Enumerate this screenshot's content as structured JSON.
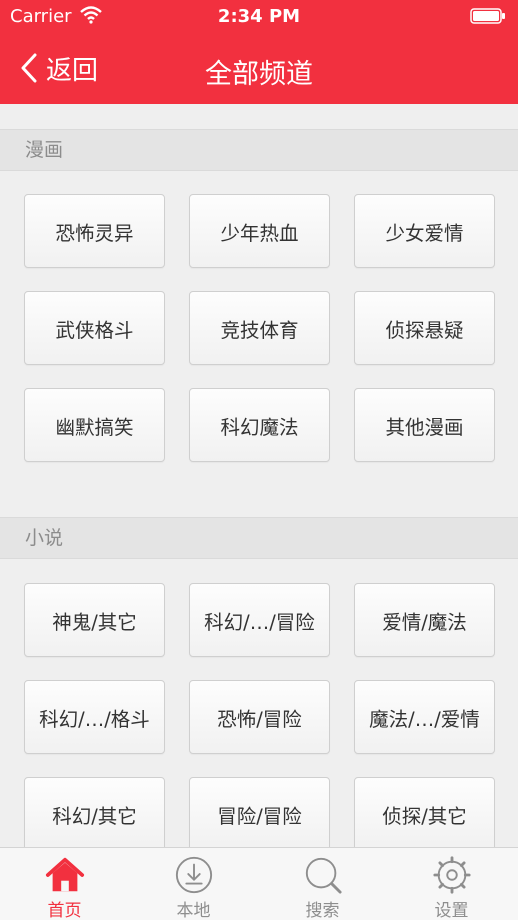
{
  "status_bar": {
    "carrier": "Carrier",
    "time": "2:34 PM"
  },
  "nav": {
    "back_label": "返回",
    "title": "全部频道"
  },
  "sections": [
    {
      "title": "漫画",
      "items": [
        "恐怖灵异",
        "少年热血",
        "少女爱情",
        "武侠格斗",
        "竞技体育",
        "侦探悬疑",
        "幽默搞笑",
        "科幻魔法",
        "其他漫画"
      ]
    },
    {
      "title": "小说",
      "items": [
        "神鬼/其它",
        "科幻/…/冒险",
        "爱情/魔法",
        "科幻/…/格斗",
        "恐怖/冒险",
        "魔法/…/爱情",
        "科幻/其它",
        "冒险/冒险",
        "侦探/其它"
      ]
    }
  ],
  "tabs": [
    {
      "label": "首页",
      "icon": "home-icon",
      "active": true
    },
    {
      "label": "本地",
      "icon": "download-icon",
      "active": false
    },
    {
      "label": "搜索",
      "icon": "search-icon",
      "active": false
    },
    {
      "label": "设置",
      "icon": "gear-icon",
      "active": false
    }
  ],
  "colors": {
    "accent": "#f2303f",
    "inactive": "#8e8e8e"
  }
}
